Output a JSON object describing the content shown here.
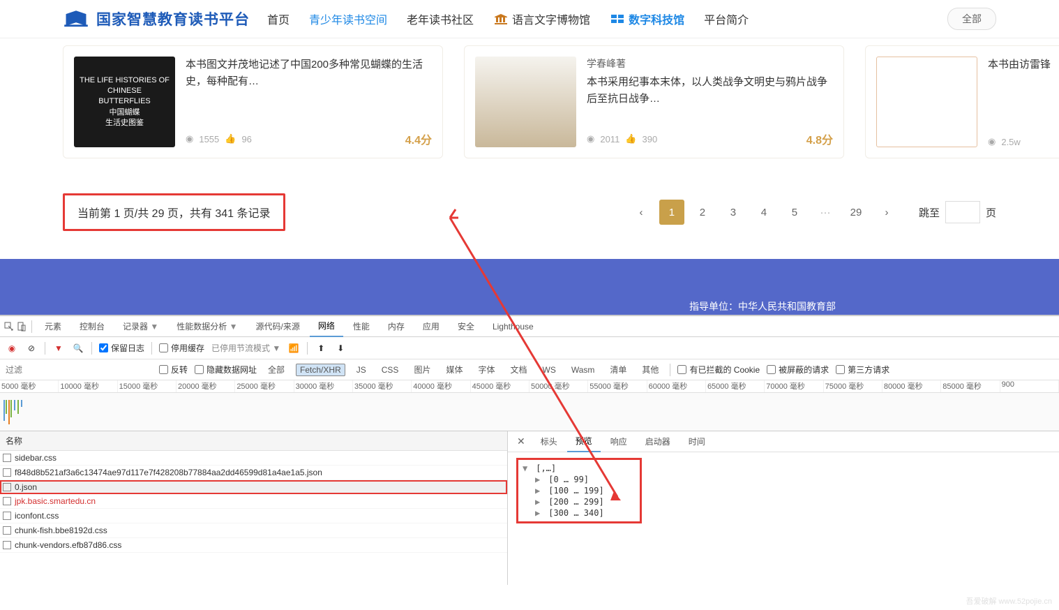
{
  "header": {
    "logo_text": "国家智慧教育读书平台",
    "nav": [
      "首页",
      "青少年读书空间",
      "老年读书社区",
      "语言文字博物馆",
      "数字科技馆",
      "平台简介"
    ],
    "active_nav": 1,
    "special_nav": 4,
    "filter_label": "全部"
  },
  "cards": [
    {
      "cover_text": "THE LIFE HISTORIES OF\nCHINESE\nBUTTERFLIES\n中国蝴蝶\n生活史图鉴",
      "desc": "本书图文并茂地记述了中国200多种常见蝴蝶的生活史，每种配有…",
      "views": "1555",
      "likes": "96",
      "rating": "4.4分"
    },
    {
      "author": "学春峰著",
      "desc": "本书采用纪事本末体，以人类战争文明史与鸦片战争后至抗日战争…",
      "views": "2011",
      "likes": "390",
      "rating": "4.8分"
    },
    {
      "desc": "本书由访雷锋",
      "views": "2.5w"
    }
  ],
  "pagination": {
    "info": "当前第 1 页/共 29 页，共有 341 条记录",
    "pages": [
      "1",
      "2",
      "3",
      "4",
      "5",
      "···",
      "29"
    ],
    "active": 0,
    "jump_label_pre": "跳至",
    "jump_label_post": "页"
  },
  "footer": {
    "text": "指导单位：中华人民共和国教育部"
  },
  "devtools": {
    "tabs": [
      "元素",
      "控制台",
      "记录器",
      "性能数据分析",
      "源代码/来源",
      "网络",
      "性能",
      "内存",
      "应用",
      "安全",
      "Lighthouse"
    ],
    "active_tab": 5,
    "toolbar": {
      "preserve_log": "保留日志",
      "disable_cache": "停用缓存",
      "throttling": "已停用节流模式"
    },
    "filter": {
      "placeholder": "过滤",
      "invert": "反转",
      "hide_data": "隐藏数据网址",
      "types": [
        "全部",
        "Fetch/XHR",
        "JS",
        "CSS",
        "图片",
        "媒体",
        "字体",
        "文档",
        "WS",
        "Wasm",
        "清单",
        "其他"
      ],
      "active_type": 1,
      "blocked_cookies": "有已拦截的 Cookie",
      "blocked_requests": "被屏蔽的请求",
      "third_party": "第三方请求"
    },
    "timeline": [
      "5000 毫秒",
      "10000 毫秒",
      "15000 毫秒",
      "20000 毫秒",
      "25000 毫秒",
      "30000 毫秒",
      "35000 毫秒",
      "40000 毫秒",
      "45000 毫秒",
      "50000 毫秒",
      "55000 毫秒",
      "60000 毫秒",
      "65000 毫秒",
      "70000 毫秒",
      "75000 毫秒",
      "80000 毫秒",
      "85000 毫秒",
      "900"
    ],
    "name_header": "名称",
    "requests": [
      {
        "name": "sidebar.css"
      },
      {
        "name": "f848d8b521af3a6c13474ae97d117e7f428208b77884aa2dd46599d81a4ae1a5.json"
      },
      {
        "name": "0.json",
        "highlighted": true
      },
      {
        "name": "jpk.basic.smartedu.cn",
        "red": true
      },
      {
        "name": "iconfont.css"
      },
      {
        "name": "chunk-fish.bbe8192d.css"
      },
      {
        "name": "chunk-vendors.efb87d86.css"
      }
    ],
    "detail_tabs": [
      "标头",
      "预览",
      "响应",
      "启动器",
      "时间"
    ],
    "active_detail": 1,
    "preview": {
      "root": "[,…]",
      "ranges": [
        "[0 … 99]",
        "[100 … 199]",
        "[200 … 299]",
        "[300 … 340]"
      ]
    }
  },
  "watermark": "吾爱破解 www.52pojie.cn"
}
